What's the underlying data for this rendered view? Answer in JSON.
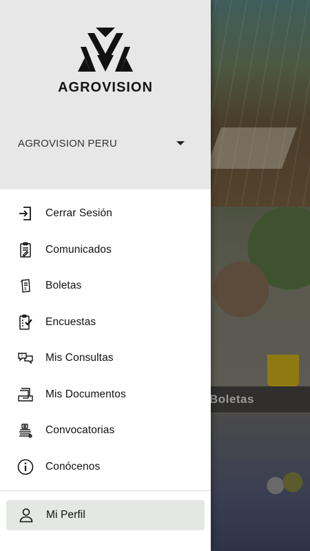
{
  "background": {
    "section_label": "Boletas"
  },
  "drawer": {
    "brand": "AGROVISION",
    "account": {
      "name": "AGROVISION PERU"
    },
    "menu": [
      {
        "label": "Cerrar Sesión",
        "icon": "logout-icon"
      },
      {
        "label": "Comunicados",
        "icon": "clipboard-note-icon"
      },
      {
        "label": "Boletas",
        "icon": "payslip-icon"
      },
      {
        "label": "Encuestas",
        "icon": "survey-checklist-icon"
      },
      {
        "label": "Mis Consultas",
        "icon": "chat-bubbles-icon"
      },
      {
        "label": "Mis Documentos",
        "icon": "documents-icon"
      },
      {
        "label": "Convocatorias",
        "icon": "calls-stack-icon"
      },
      {
        "label": "Conócenos",
        "icon": "info-icon"
      }
    ],
    "profile": {
      "label": "Mi Perfil",
      "icon": "person-icon"
    }
  }
}
